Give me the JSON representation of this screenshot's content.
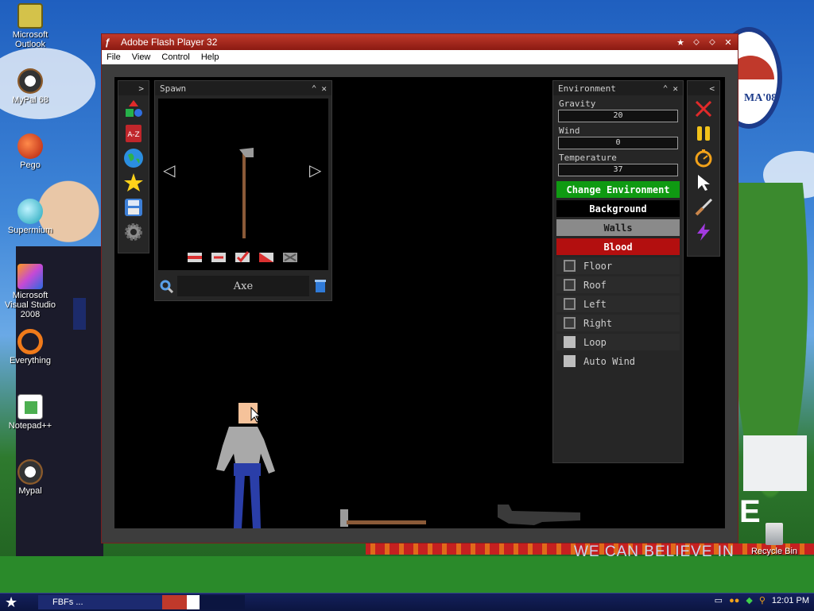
{
  "desktop": {
    "icons": [
      {
        "label": "Microsoft Outlook",
        "icon": "outlook-icon"
      },
      {
        "label": "MyPal 68",
        "icon": "mypal-icon"
      },
      {
        "label": "Pego",
        "icon": "pego-icon"
      },
      {
        "label": "Supermium",
        "icon": "supermium-icon"
      },
      {
        "label": "Microsoft Visual Studio 2008",
        "icon": "visual-studio-icon"
      },
      {
        "label": "Everything",
        "icon": "everything-icon"
      },
      {
        "label": "Notepad++",
        "icon": "notepadpp-icon"
      },
      {
        "label": "Mypal",
        "icon": "mypal-icon"
      },
      {
        "label": "Recycle Bin",
        "icon": "recycle-bin-icon"
      }
    ],
    "wallpaper_text": {
      "badge": "MA'08",
      "slogan": "WE CAN BELIEVE IN",
      "big_letter": "E"
    }
  },
  "window": {
    "title": "Adobe Flash Player 32",
    "menu": [
      "File",
      "View",
      "Control",
      "Help"
    ]
  },
  "game": {
    "left_toolbar": {
      "collapse_arrow": ">",
      "tools": [
        "shapes-icon",
        "a-z-icon",
        "globe-icon",
        "star-icon",
        "save-icon",
        "gear-icon"
      ]
    },
    "spawn_panel": {
      "title": "Spawn",
      "item_name": "Axe",
      "prev_arrow": "◁",
      "next_arrow": "▷",
      "bottom_tools": [
        "flip-icon",
        "rotate-icon",
        "check-icon",
        "frozen-icon",
        "block-icon"
      ]
    },
    "environment_panel": {
      "title": "Environment",
      "fields": [
        {
          "label": "Gravity",
          "value": "20"
        },
        {
          "label": "Wind",
          "value": "0"
        },
        {
          "label": "Temperature",
          "value": "37"
        }
      ],
      "buttons": [
        {
          "label": "Change Environment",
          "bg": "#0f9a12",
          "fg": "#ffffff"
        },
        {
          "label": "Background",
          "bg": "#000000",
          "fg": "#ffffff"
        },
        {
          "label": "Walls",
          "bg": "#8a8a8a",
          "fg": "#1a1a1a"
        },
        {
          "label": "Blood",
          "bg": "#b30f0f",
          "fg": "#ffffff"
        }
      ],
      "checkboxes": [
        {
          "label": "Floor",
          "checked": false
        },
        {
          "label": "Roof",
          "checked": false
        },
        {
          "label": "Left",
          "checked": false
        },
        {
          "label": "Right",
          "checked": false
        },
        {
          "label": "Loop",
          "checked": true
        },
        {
          "label": "Auto Wind",
          "checked": true
        }
      ]
    },
    "right_toolbar": {
      "collapse_arrow": "<",
      "tools": [
        "close-x-icon",
        "pause-icon",
        "stopwatch-icon",
        "pointer-icon",
        "knife-icon",
        "lightning-icon"
      ]
    }
  },
  "taskbar": {
    "task_label": "FBFs ...",
    "clock": "12:01 PM"
  }
}
